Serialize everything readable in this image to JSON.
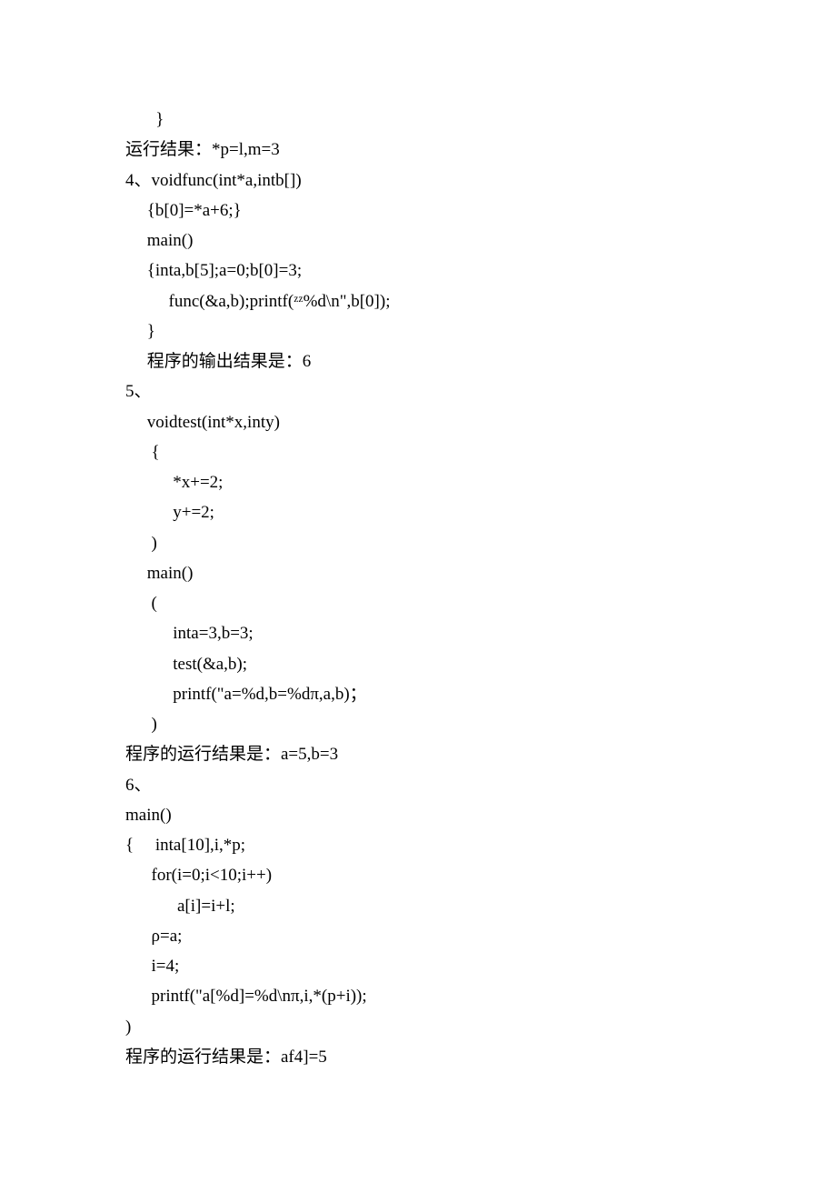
{
  "lines": [
    "       }",
    "运行结果：*p=l,m=3",
    "",
    "4、voidfunc(int*a,intb[])",
    "     {b[0]=*a+6;}",
    "     main()",
    "     {inta,b[5];a=0;b[0]=3;",
    "          func(&a,b);printf(ᶻᶻ%d\\n\",b[0]);",
    "     }",
    "     程序的输出结果是：6",
    "5、",
    "     voidtest(int*x,inty)",
    "      {",
    "           *x+=2;",
    "           y+=2;",
    "      )",
    "     main()",
    "      (",
    "           inta=3,b=3;",
    "           test(&a,b);",
    "           printf(\"a=%d,b=%dπ,a,b)；",
    "      )",
    "程序的运行结果是：a=5,b=3",
    "",
    "6、",
    "main()",
    "{     inta[10],i,*p;",
    "      for(i=0;i<10;i++)",
    "            a[i]=i+l;",
    "      ρ=a;",
    "      i=4;",
    "      printf(\"a[%d]=%d\\nπ,i,*(p+i));",
    ")",
    "程序的运行结果是：af4]=5"
  ]
}
